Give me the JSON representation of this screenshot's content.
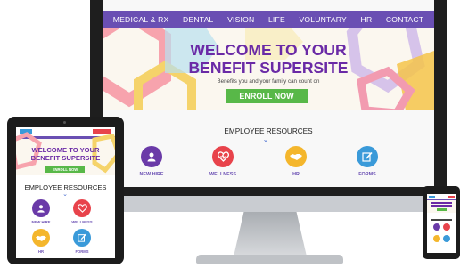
{
  "desktop": {
    "nav": [
      "MEDICAL & RX",
      "DENTAL",
      "VISION",
      "LIFE",
      "VOLUNTARY",
      "HR",
      "CONTACT"
    ],
    "hero_title_line1": "WELCOME TO YOUR",
    "hero_title_line2": "BENEFIT SUPERSITE",
    "hero_subtitle": "Benefits you and your family can count on",
    "enroll_label": "ENROLL NOW",
    "resources_title": "EMPLOYEE RESOURCES",
    "resources": [
      {
        "label": "NEW HIRE",
        "icon": "person-icon",
        "color": "#6a3aa8"
      },
      {
        "label": "WELLNESS",
        "icon": "heart-icon",
        "color": "#e8434b"
      },
      {
        "label": "HR",
        "icon": "handshake-icon",
        "color": "#f4b62c"
      },
      {
        "label": "FORMS",
        "icon": "edit-icon",
        "color": "#3a9ad9"
      }
    ]
  },
  "tablet": {
    "hero_title_line1": "WELCOME TO YOUR",
    "hero_title_line2": "BENEFIT SUPERSITE",
    "enroll_label": "ENROLL NOW",
    "resources_title": "EMPLOYEE RESOURCES",
    "resources": [
      {
        "label": "NEW HIRE",
        "icon": "person-icon",
        "color": "#6a3aa8"
      },
      {
        "label": "WELLNESS",
        "icon": "heart-icon",
        "color": "#e8434b"
      },
      {
        "label": "HR",
        "icon": "handshake-icon",
        "color": "#f4b62c"
      },
      {
        "label": "FORMS",
        "icon": "edit-icon",
        "color": "#3a9ad9"
      }
    ]
  },
  "colors": {
    "nav": "#6a4fb3",
    "title": "#6a2aa6",
    "enroll": "#58b848"
  }
}
